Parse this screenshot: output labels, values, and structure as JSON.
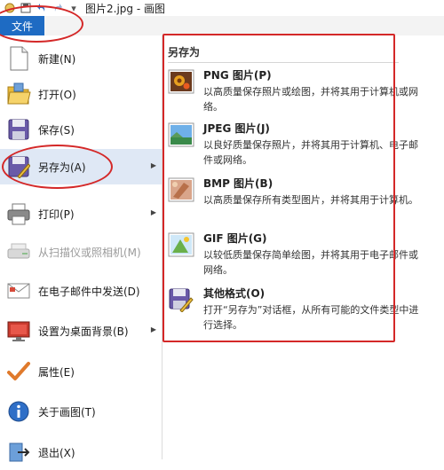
{
  "window": {
    "title": "图片2.jpg - 画图"
  },
  "file_tab": {
    "label": "文件"
  },
  "menu": {
    "items": [
      {
        "label": "新建(N)",
        "icon": "new-document-icon"
      },
      {
        "label": "打开(O)",
        "icon": "open-folder-icon"
      },
      {
        "label": "保存(S)",
        "icon": "save-disk-icon"
      },
      {
        "label": "另存为(A)",
        "icon": "save-as-icon"
      },
      {
        "label": "打印(P)",
        "icon": "printer-icon"
      },
      {
        "label": "从扫描仪或照相机(M)",
        "icon": "scanner-icon"
      },
      {
        "label": "在电子邮件中发送(D)",
        "icon": "email-icon"
      },
      {
        "label": "设置为桌面背景(B)",
        "icon": "desktop-background-icon"
      },
      {
        "label": "属性(E)",
        "icon": "checkmark-icon"
      },
      {
        "label": "关于画图(T)",
        "icon": "info-icon"
      },
      {
        "label": "退出(X)",
        "icon": "exit-icon"
      }
    ]
  },
  "save_as_panel": {
    "header": "另存为",
    "options": [
      {
        "title": "PNG 图片(P)",
        "desc": "以高质量保存照片或绘图，并将其用于计算机或网络。",
        "icon": "png-image-icon"
      },
      {
        "title": "JPEG 图片(J)",
        "desc": "以良好质量保存照片，并将其用于计算机、电子邮件或网络。",
        "icon": "jpeg-image-icon"
      },
      {
        "title": "BMP 图片(B)",
        "desc": "以高质量保存所有类型图片，并将其用于计算机。",
        "icon": "bmp-image-icon"
      },
      {
        "title": "GIF 图片(G)",
        "desc": "以较低质量保存简单绘图，并将其用于电子邮件或网络。",
        "icon": "gif-image-icon"
      },
      {
        "title": "其他格式(O)",
        "desc": "打开“另存为”对话框，从所有可能的文件类型中进行选择。",
        "icon": "other-formats-icon"
      }
    ]
  },
  "colors": {
    "accent": "#1e6bc3",
    "annotation": "#d42828",
    "selected": "#dfe8f5"
  }
}
